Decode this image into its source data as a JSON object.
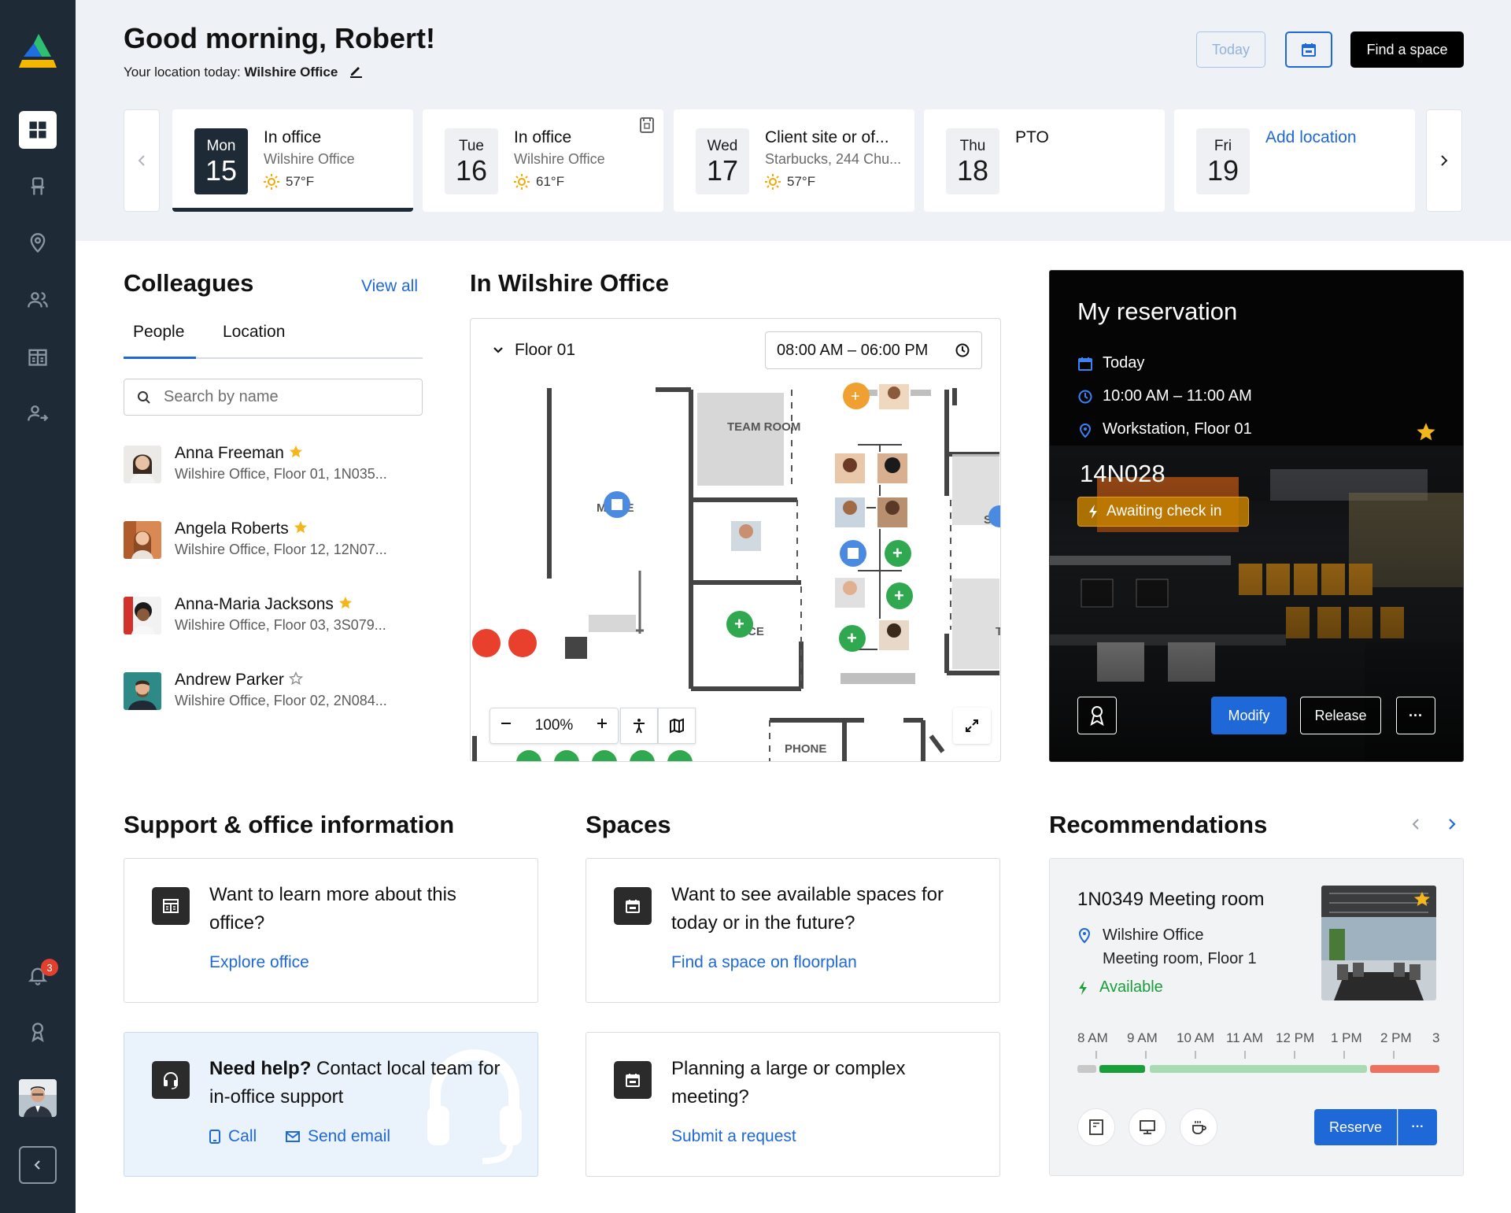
{
  "header": {
    "greeting": "Good morning, Robert!",
    "location_prefix": "Your location today:",
    "location": "Wilshire Office",
    "today_button": "Today",
    "find_space_button": "Find a space"
  },
  "days": [
    {
      "dow": "Mon",
      "num": "15",
      "title": "In office",
      "subtitle": "Wilshire Office",
      "weather": "57°F",
      "active": true
    },
    {
      "dow": "Tue",
      "num": "16",
      "title": "In office",
      "subtitle": "Wilshire Office",
      "weather": "61°F"
    },
    {
      "dow": "Wed",
      "num": "17",
      "title": "Client site or of...",
      "subtitle": "Starbucks, 244 Chu...",
      "weather": "57°F"
    },
    {
      "dow": "Thu",
      "num": "18",
      "title": "PTO",
      "subtitle": "",
      "weather": ""
    },
    {
      "dow": "Fri",
      "num": "19",
      "title": "Add location",
      "subtitle": "",
      "weather": ""
    }
  ],
  "colleagues": {
    "title": "Colleagues",
    "view_all": "View all",
    "tabs": [
      "People",
      "Location"
    ],
    "search_placeholder": "Search by name",
    "people": [
      {
        "name": "Anna Freeman",
        "location": "Wilshire Office, Floor 01, 1N035...",
        "favorite": true
      },
      {
        "name": "Angela Roberts",
        "location": "Wilshire Office, Floor 12, 12N07...",
        "favorite": true
      },
      {
        "name": "Anna-Maria Jacksons",
        "location": "Wilshire Office, Floor 03, 3S079...",
        "favorite": true
      },
      {
        "name": "Andrew Parker",
        "location": "Wilshire Office, Floor 02, 2N084...",
        "favorite": false
      }
    ]
  },
  "map": {
    "title": "In Wilshire Office",
    "floor": "Floor 01",
    "time_range": "08:00 AM – 06:00 PM",
    "zoom": "100%",
    "room_labels": {
      "team_room": "TEAM ROOM",
      "phone": "PHONE",
      "house": "M    USE",
      "office": "CE",
      "sr": "SR",
      "tr": "T R"
    }
  },
  "reservation": {
    "title": "My reservation",
    "date": "Today",
    "time": "10:00 AM – 11:00 AM",
    "place": "Workstation, Floor 01",
    "code": "14N028",
    "status": "Awaiting check in",
    "modify": "Modify",
    "release": "Release",
    "more": "···"
  },
  "support": {
    "title": "Support & office information",
    "learn_question": "Want to learn more about this office?",
    "learn_link": "Explore office",
    "help_bold": "Need help?",
    "help_text": " Contact local team for in-office support",
    "call": "Call",
    "email": "Send email"
  },
  "spaces": {
    "title": "Spaces",
    "available_question": "Want to see available spaces for today or in the future?",
    "available_link": "Find a space on floorplan",
    "planning_question": "Planning a large or complex meeting?",
    "planning_link": "Submit a request"
  },
  "recommendations": {
    "title": "Recommendations",
    "room": "1N0349 Meeting room",
    "building": "Wilshire Office",
    "room_detail": "Meeting room, Floor 1",
    "status": "Available",
    "hours": [
      "8 AM",
      "9 AM",
      "10 AM",
      "11 AM",
      "12 PM",
      "1 PM",
      "2 PM",
      "3"
    ],
    "reserve": "Reserve",
    "more": "···"
  },
  "notifications": {
    "count": "3"
  },
  "colors": {
    "accent": "#1f68d8",
    "sidebar": "#1e2a36",
    "available": "#1a9e3a",
    "warning": "#e8a000",
    "busy": "#e2402f"
  }
}
